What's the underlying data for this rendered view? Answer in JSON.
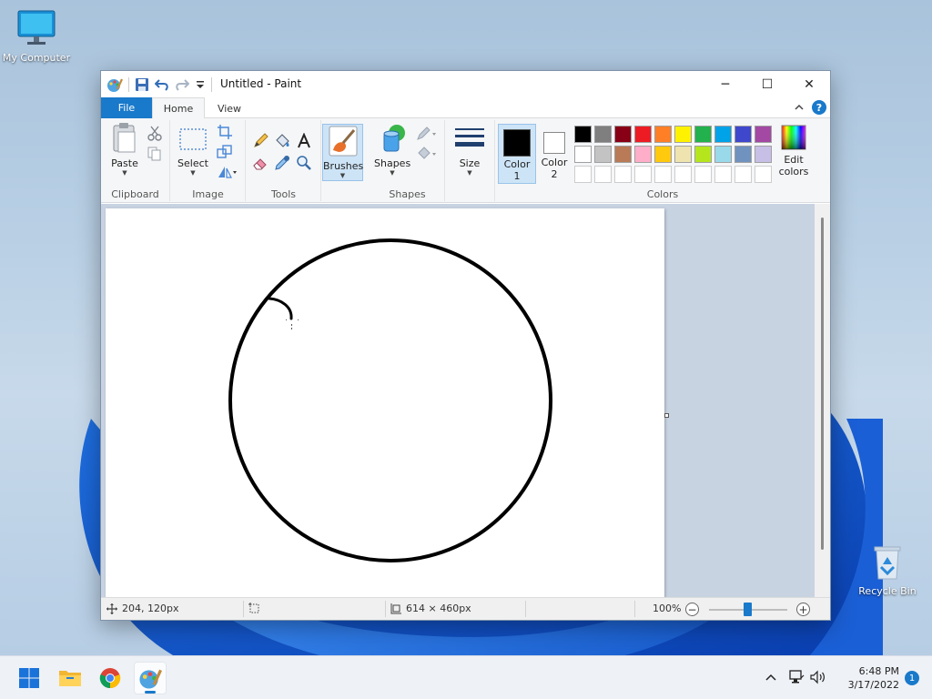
{
  "desktop": {
    "icons": [
      {
        "label": "My Computer"
      },
      {
        "label": "Recycle Bin"
      }
    ]
  },
  "window": {
    "title": "Untitled - Paint",
    "controls": {
      "minimize": "─",
      "maximize": "☐",
      "close": "✕"
    }
  },
  "ribbon": {
    "tabs": {
      "file": "File",
      "home": "Home",
      "view": "View"
    },
    "help": "?",
    "groups": {
      "clipboard": {
        "label": "Clipboard",
        "paste": "Paste"
      },
      "image": {
        "label": "Image",
        "select": "Select"
      },
      "tools": {
        "label": "Tools"
      },
      "brushes": {
        "label": "Brushes"
      },
      "shapes": {
        "label": "Shapes",
        "shapes_btn": "Shapes"
      },
      "size": {
        "label": "Size"
      },
      "colors": {
        "label": "Colors",
        "color1": "Color",
        "color1_num": "1",
        "color2": "Color",
        "color2_num": "2",
        "edit": "Edit",
        "edit2": "colors",
        "row1": [
          "#000000",
          "#7f7f7f",
          "#880015",
          "#ed1c24",
          "#ff7f27",
          "#fff200",
          "#22b14c",
          "#00a2e8",
          "#3f48cc",
          "#a349a4"
        ],
        "row2": [
          "#ffffff",
          "#c3c3c3",
          "#b97a57",
          "#ffaec9",
          "#ffc90e",
          "#efe4b0",
          "#b5e61d",
          "#99d9ea",
          "#7092be",
          "#c8bfe7"
        ]
      }
    }
  },
  "status": {
    "cursor_pos": "204, 120px",
    "canvas_size": "614 × 460px",
    "zoom": "100%"
  },
  "taskbar": {
    "time": "6:48 PM",
    "date": "3/17/2022",
    "notifications": "1"
  }
}
